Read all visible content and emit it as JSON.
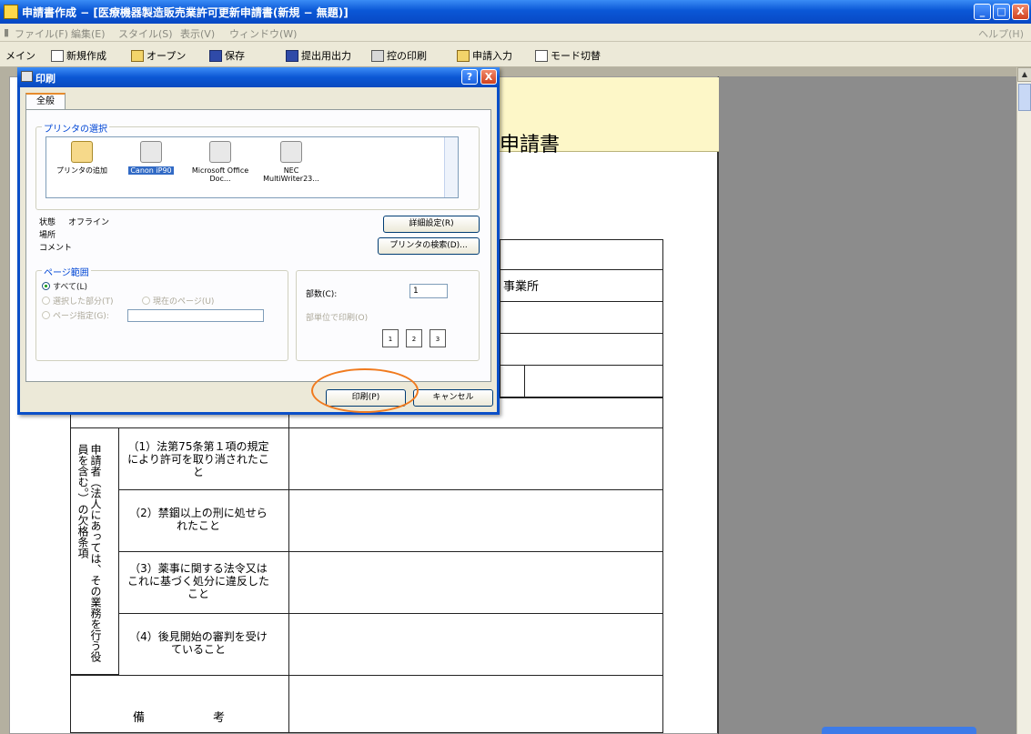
{
  "window": {
    "title": "申請書作成 − [医療機器製造販売業許可更新申請書(新規 − 無題)]",
    "menu": [
      "ファイル(F)",
      "編集(E)",
      "スタイル(S)",
      "表示(V)",
      "ウィンドウ(W)"
    ],
    "menu_help": "ヘルプ(H)",
    "btn_min": "_",
    "btn_max": "□",
    "btn_close": "X"
  },
  "toolbar": {
    "items": [
      "メイン",
      "新規作成",
      "オープン",
      "保存",
      "提出用出力",
      "控の印刷",
      "申請入力",
      "モード切替"
    ]
  },
  "document": {
    "title": "申請書",
    "cell_jigyosho": "事業所",
    "vertical_heading": "申請者（法人にあっては、その業務を行う役員を含む。）の欠格条項",
    "items": [
      "（1）法第75条第１項の規定により許可を取り消されたこと",
      "（2）禁錮以上の刑に処せられたこと",
      "（3）薬事に関する法令又はこれに基づく処分に違反したこと",
      "（4）後見開始の審判を受けていること"
    ],
    "remarks_1": "備",
    "remarks_2": "考"
  },
  "dialog": {
    "title": "印刷",
    "help": "?",
    "close": "X",
    "tab_general": "全般",
    "printer_group_label": "プリンタの選択",
    "printers": [
      {
        "name": "プリンタの追加",
        "icon": "add-printer-icon",
        "selected": false
      },
      {
        "name": "Canon iP90",
        "icon": "printer-icon",
        "selected": true
      },
      {
        "name": "Microsoft Office Doc...",
        "icon": "printer-icon",
        "selected": false
      },
      {
        "name": "NEC MultiWriter23...",
        "icon": "printer-icon",
        "selected": false
      }
    ],
    "status_label": "状態",
    "status_value": "オフライン",
    "location_label": "場所",
    "comment_label": "コメント",
    "btn_details": "詳細設定(R)",
    "btn_find": "プリンタの検索(D)...",
    "page_range_label": "ページ範囲",
    "radio_all": "すべて(L)",
    "radio_selection": "選択した部分(T)",
    "radio_current": "現在のページ(U)",
    "radio_pages": "ページ指定(G):",
    "copies_label": "部数(C):",
    "copies_value": "1",
    "collate_label": "部単位で印刷(O)",
    "btn_print": "印刷(P)",
    "btn_cancel": "キャンセル"
  }
}
